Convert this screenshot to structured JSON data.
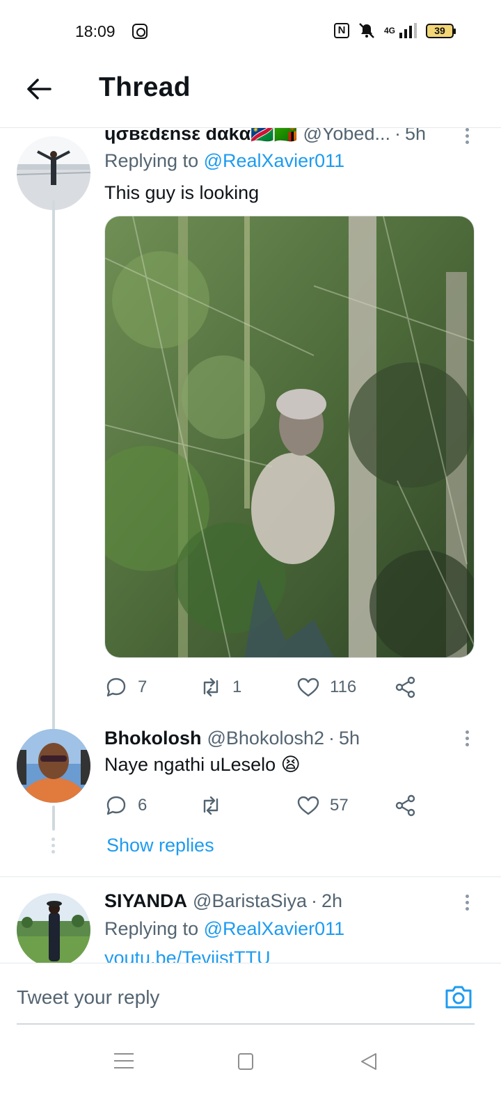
{
  "status_bar": {
    "time": "18:09",
    "network": "4G",
    "battery": "39",
    "icons": [
      "instagram-icon",
      "nfc-icon",
      "mute-icon",
      "signal-icon",
      "battery-icon"
    ]
  },
  "header": {
    "title": "Thread",
    "back_icon": "arrow-left-icon"
  },
  "tweets": [
    {
      "name": "ɥσвεdεnsε dαkα🇳🇦🇿🇲",
      "handle": "@Yobed...",
      "separator": "·",
      "time": "5h",
      "replying_label": "Replying to",
      "replying_to": "@RealXavier011",
      "text": "This guy is looking",
      "has_media": true,
      "stats": {
        "replies": "7",
        "retweets": "1",
        "likes": "116"
      }
    },
    {
      "name": "Bhokolosh",
      "handle": "@Bhokolosh2",
      "separator": "·",
      "time": "5h",
      "text": "Naye ngathi uLeselo 😫",
      "stats": {
        "replies": "6",
        "retweets": "",
        "likes": "57"
      },
      "show_replies": "Show replies"
    },
    {
      "name": "SIYANDA",
      "handle": "@BaristaSiya",
      "separator": "·",
      "time": "2h",
      "replying_label": "Replying to",
      "replying_to": "@RealXavier011",
      "text": "youtu.be/TeviistTTU"
    }
  ],
  "reply_bar": {
    "placeholder": "Tweet your reply",
    "camera_icon": "camera-icon"
  },
  "nav_bar": {
    "icons": [
      "recent-apps-icon",
      "home-icon",
      "back-icon"
    ]
  },
  "colors": {
    "accent": "#1d9bf0",
    "text_primary": "#0f1419",
    "text_secondary": "#536471",
    "divider": "#e6e9eb",
    "thread_line": "#cfd9de"
  }
}
